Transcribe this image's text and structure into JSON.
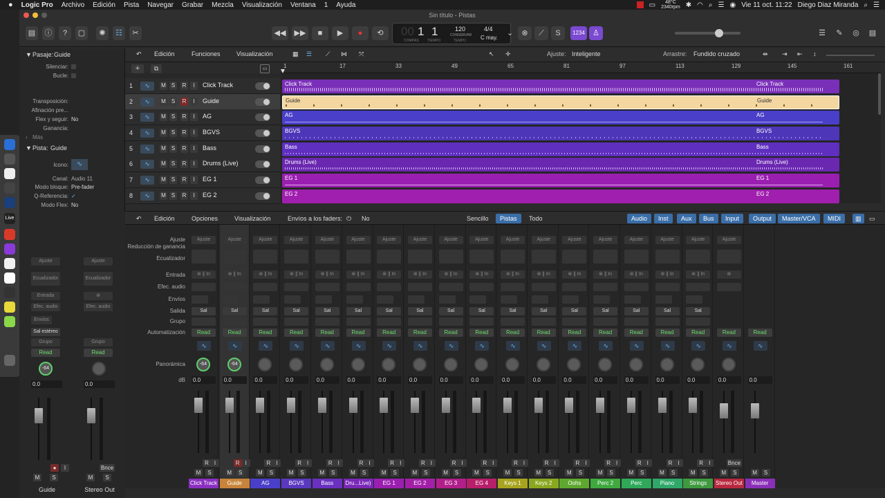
{
  "menubar": {
    "app": "Logic Pro",
    "items": [
      "Archivo",
      "Edición",
      "Pista",
      "Navegar",
      "Grabar",
      "Mezcla",
      "Visualización",
      "Ventana",
      "1",
      "Ayuda"
    ],
    "temp": "48°C",
    "rpm": "2340rpm",
    "datetime": "Vie 11 oct.  11:22",
    "user": "Diego Diaz Miranda"
  },
  "window": {
    "title": "Sin título - Pistas"
  },
  "lcd": {
    "bar": "1",
    "beat": "1",
    "bpm": "120",
    "bpm_sub": "CONSERVAR",
    "compas_lbl": "COMPÁS",
    "tiempo_lbl": "TIEMPO",
    "tempo_lbl": "TEMPO",
    "sig": "4/4",
    "key": "C may.",
    "count_in": "1234"
  },
  "inspector": {
    "region_title": "Pasaje:",
    "region_name": "Guide",
    "silenciar": "Silenciar:",
    "bucle": "Bucle:",
    "transposicion": "Transposición:",
    "afinacion": "Afinación pre...",
    "flex": "Flex y seguir:",
    "flex_v": "No",
    "ganancia": "Ganancia:",
    "mas": "Más",
    "track_title": "Pista:",
    "track_name": "Guide",
    "icono": "Icono:",
    "canal": "Canal:",
    "canal_v": "Audio 11",
    "modo_bloque": "Modo bloque:",
    "modo_bloque_v": "Pre-fader",
    "qref": "Q-Referencia:",
    "qref_v": "✓",
    "modo_flex": "Modo Flex:",
    "modo_flex_v": "No"
  },
  "tracks_header": {
    "edicion": "Edición",
    "funciones": "Funciones",
    "visualizacion": "Visualización",
    "ajuste_lbl": "Ajuste:",
    "ajuste_v": "Inteligente",
    "arrastre_lbl": "Arrastre:",
    "arrastre_v": "Fundido cruzado"
  },
  "ruler": [
    "1",
    "17",
    "33",
    "49",
    "65",
    "81",
    "97",
    "113",
    "129",
    "145",
    "161"
  ],
  "tracks": [
    {
      "num": "1",
      "name": "Click Track",
      "color": "#7a2fb8"
    },
    {
      "num": "2",
      "name": "Guide",
      "color": "#f3d6a0"
    },
    {
      "num": "3",
      "name": "AG",
      "color": "#4a3fc8"
    },
    {
      "num": "4",
      "name": "BGVS",
      "color": "#4d36b8"
    },
    {
      "num": "5",
      "name": "Bass",
      "color": "#5f2fbf"
    },
    {
      "num": "6",
      "name": "Drums (Live)",
      "color": "#6a28b0"
    },
    {
      "num": "7",
      "name": "EG 1",
      "color": "#9a1fb0"
    },
    {
      "num": "8",
      "name": "EG 2",
      "color": "#a01fae"
    }
  ],
  "tmsri": [
    "M",
    "S",
    "R",
    "I"
  ],
  "mixer_header": {
    "edicion": "Edición",
    "opciones": "Opciones",
    "visualizacion": "Visualización",
    "envios_lbl": "Envíos a los faders:",
    "envios_v": "No",
    "views": [
      "Sencillo",
      "Pistas",
      "Todo"
    ],
    "filters": [
      "Audio",
      "Inst",
      "Aux",
      "Bus",
      "Input",
      "Output",
      "Master/VCA",
      "MIDI"
    ]
  },
  "mixer_rows": [
    "Ajuste",
    "Reducción de ganancia",
    "Ecualizador",
    "Entrada",
    "Efec. audio",
    "Envíos",
    "Salida",
    "Grupo",
    "Automatización",
    "Panorámica",
    "dB"
  ],
  "strip_vals": {
    "ajuste": "Ajuste",
    "sal": "Sal",
    "read": "Read",
    "db": "0.0",
    "pan": "-64"
  },
  "strips": [
    {
      "name": "Click Track",
      "color": "#8a2fc0"
    },
    {
      "name": "Guide",
      "color": "#c8843a"
    },
    {
      "name": "AG",
      "color": "#4a3fc8"
    },
    {
      "name": "BGVS",
      "color": "#5a38c0"
    },
    {
      "name": "Bass",
      "color": "#6a30c0"
    },
    {
      "name": "Dru...Live)",
      "color": "#7a28b8"
    },
    {
      "name": "EG 1",
      "color": "#9a1fb0"
    },
    {
      "name": "EG 2",
      "color": "#a31fa8"
    },
    {
      "name": "EG 3",
      "color": "#b01f8a"
    },
    {
      "name": "EG 4",
      "color": "#b81f6a"
    },
    {
      "name": "Keys 1",
      "color": "#a8a41f"
    },
    {
      "name": "Keys 2",
      "color": "#8aa81f"
    },
    {
      "name": "Oohs",
      "color": "#5fa82f"
    },
    {
      "name": "Perc 2",
      "color": "#3fa83f"
    },
    {
      "name": "Perc",
      "color": "#2fa85a"
    },
    {
      "name": "Piano",
      "color": "#2fa86a"
    },
    {
      "name": "Strings",
      "color": "#3f9a3f"
    },
    {
      "name": "Stereo Out",
      "color": "#b8283f"
    },
    {
      "name": "Master",
      "color": "#8a2fb8"
    }
  ],
  "left_strips": {
    "guide": "Guide",
    "stereo": "Stereo Out",
    "ajuste": "Ajuste",
    "ecualizador": "Ecualizador",
    "entrada": "Entrada",
    "efec": "Efec. audio",
    "envios": "Envíos",
    "sal_estereo": "Sal estéreo",
    "grupo": "Grupo",
    "read": "Read",
    "db": "0.0",
    "pan": "-64",
    "bnce": "Bnce",
    "m": "M",
    "s": "S"
  }
}
